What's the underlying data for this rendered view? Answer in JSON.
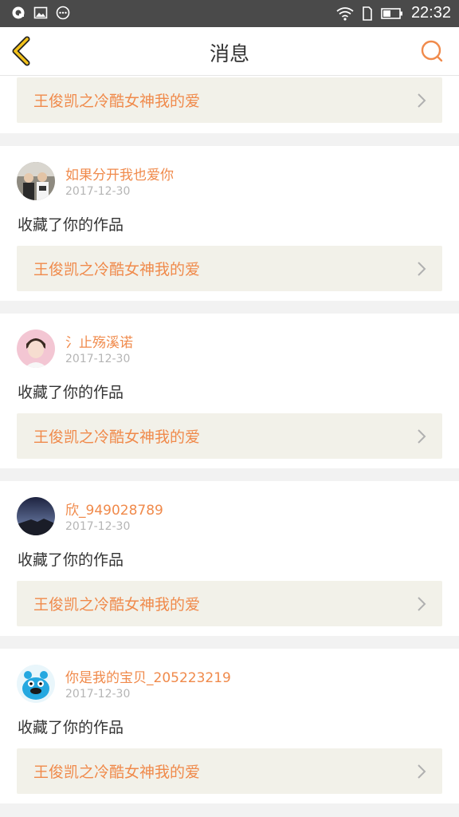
{
  "status_bar": {
    "time": "22:32",
    "icons": [
      "qq-icon",
      "gallery-icon",
      "more-dots-icon",
      "wifi-icon",
      "sim-icon",
      "battery-icon"
    ]
  },
  "header": {
    "title": "消息",
    "back_icon": "chevron-left-icon",
    "search_icon": "search-icon",
    "accent_color": "#f08a4b"
  },
  "first_card": {
    "work_title": "王俊凯之冷酷女神我的爱"
  },
  "messages": [
    {
      "username": "如果分开我也爱你",
      "date": "2017-12-30",
      "action": "收藏了你的作品",
      "work_title": "王俊凯之冷酷女神我的爱"
    },
    {
      "username": "氵止殇溪诺",
      "date": "2017-12-30",
      "action": "收藏了你的作品",
      "work_title": "王俊凯之冷酷女神我的爱"
    },
    {
      "username": "欣_949028789",
      "date": "2017-12-30",
      "action": "收藏了你的作品",
      "work_title": "王俊凯之冷酷女神我的爱"
    },
    {
      "username": "你是我的宝贝_205223219",
      "date": "2017-12-30",
      "action": "收藏了你的作品",
      "work_title": "王俊凯之冷酷女神我的爱"
    }
  ]
}
